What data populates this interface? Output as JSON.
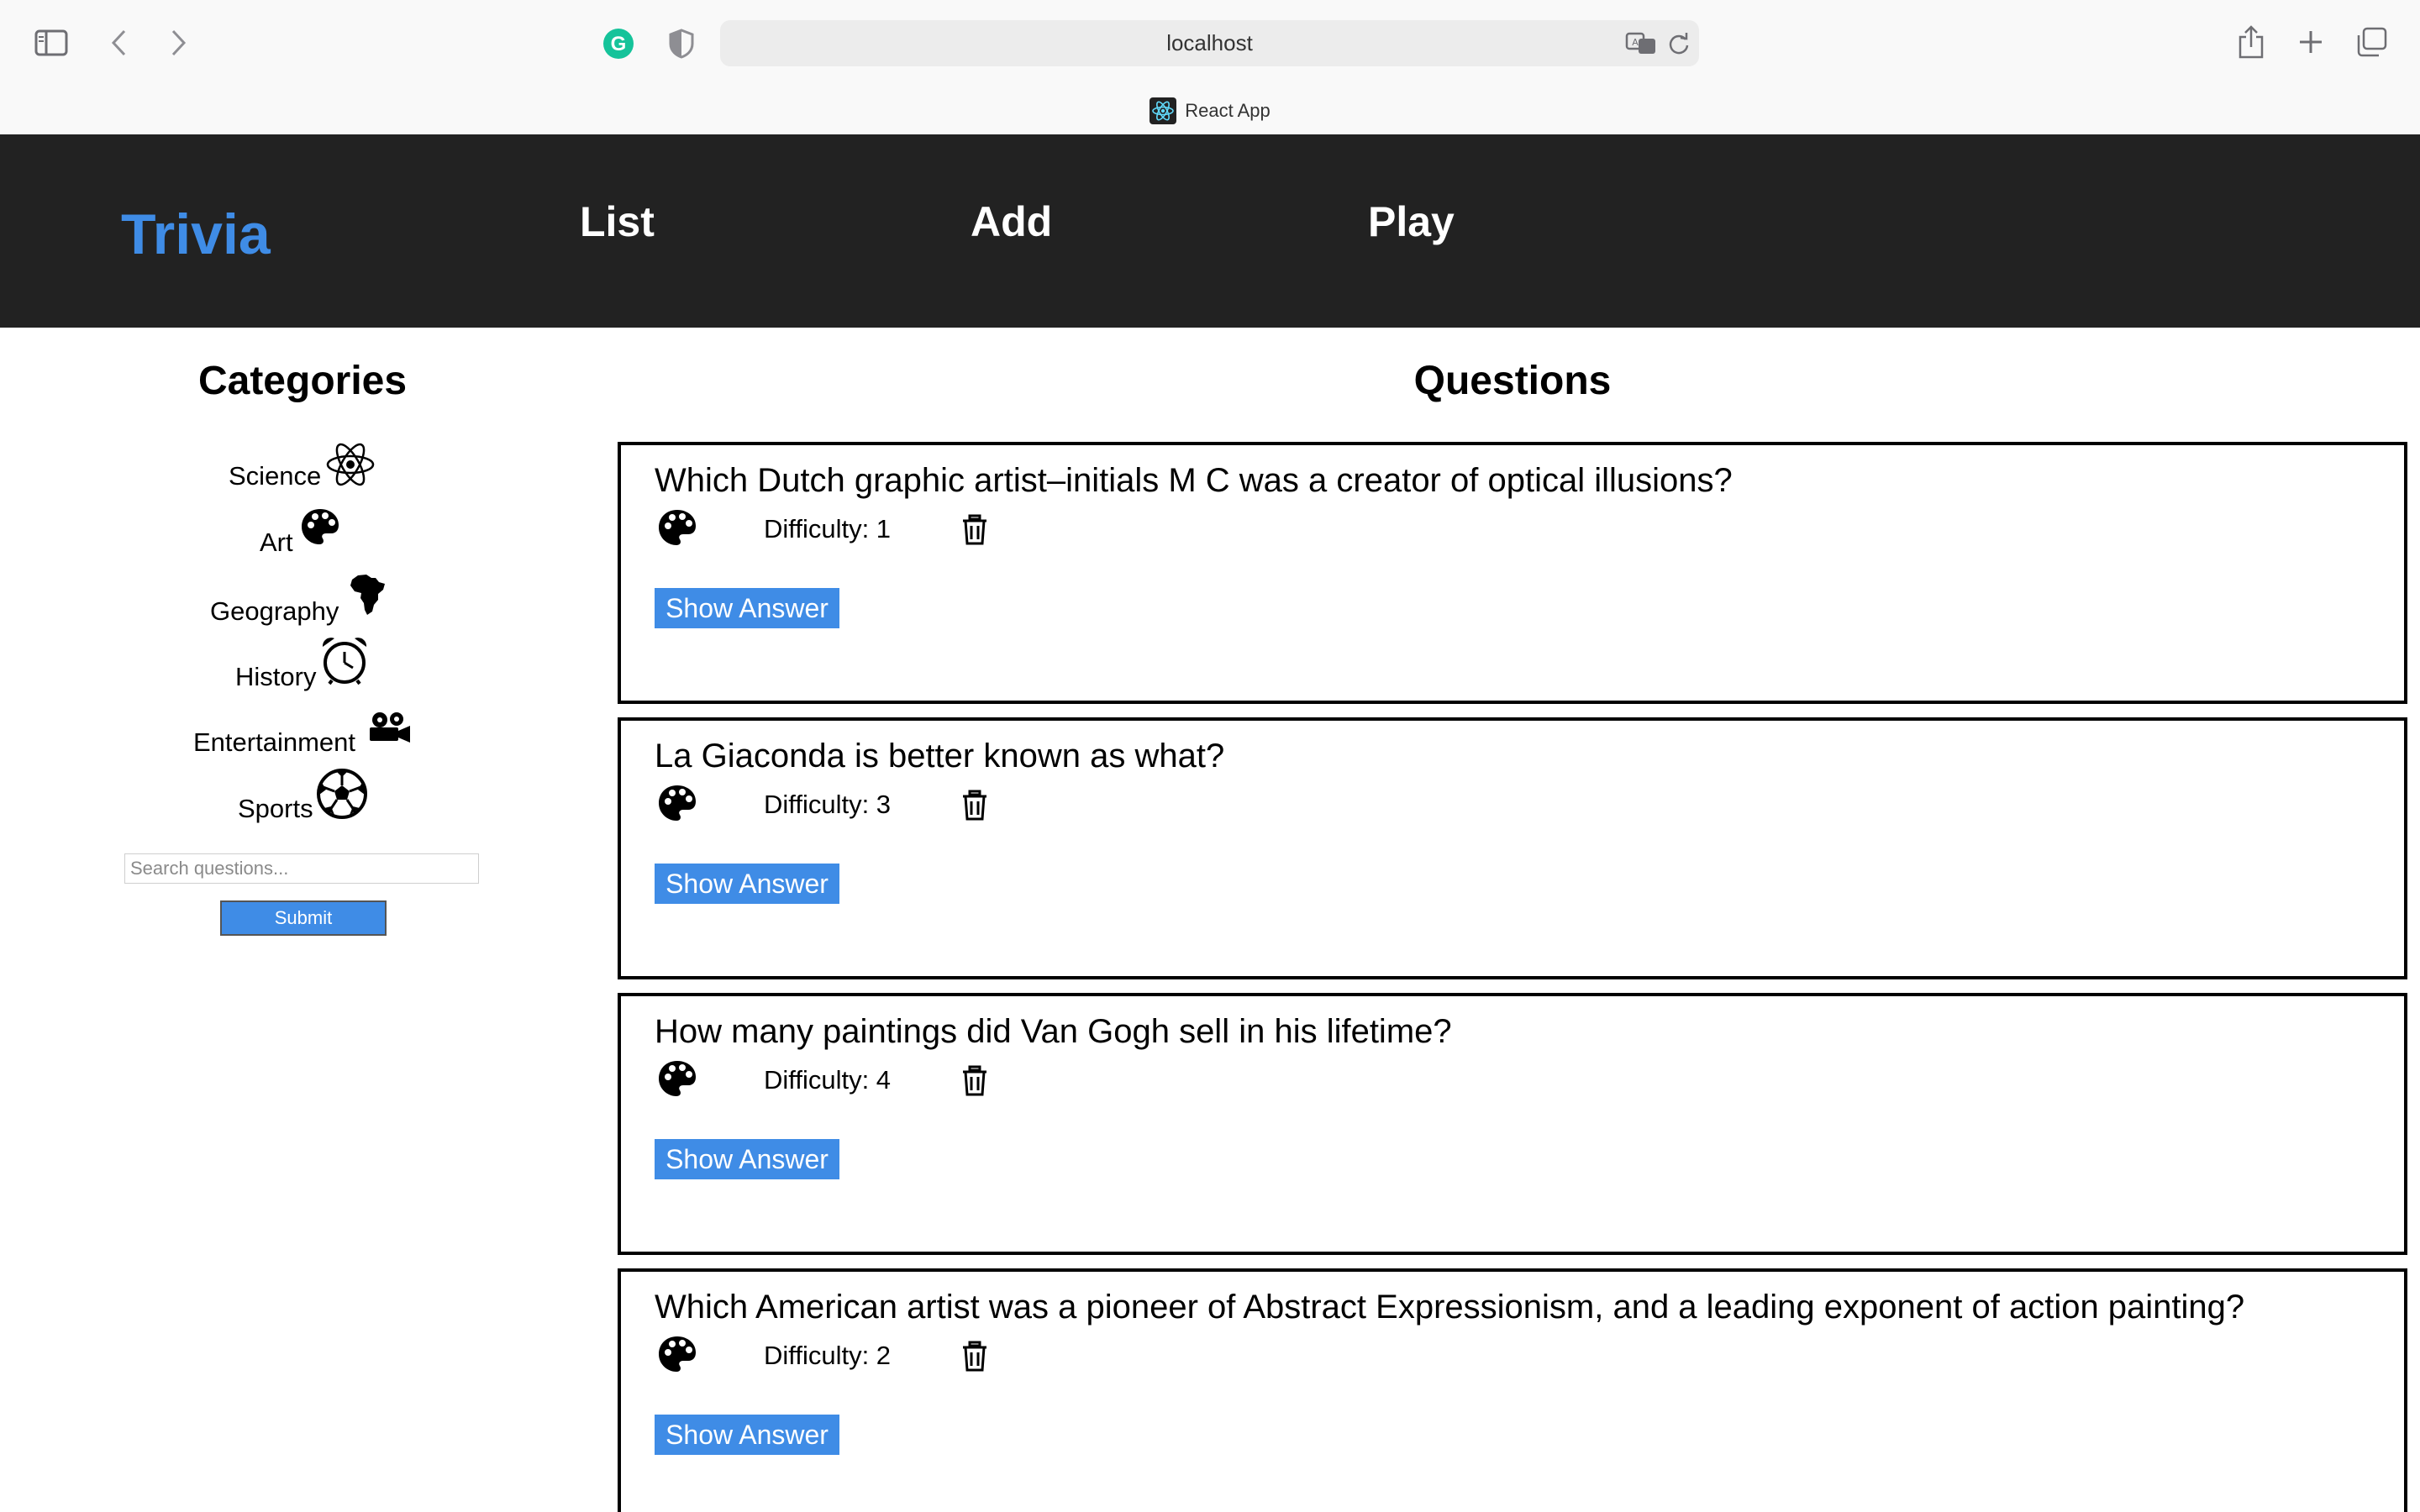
{
  "browser": {
    "url": "localhost",
    "tab_title": "React App",
    "icons": [
      "sidebar-icon",
      "back-icon",
      "forward-icon",
      "grammarly-icon",
      "shield-icon",
      "translate-icon",
      "reload-icon",
      "share-icon",
      "new-tab-icon",
      "tabs-overview-icon"
    ]
  },
  "header": {
    "brand": "Trivia",
    "nav": [
      "List",
      "Add",
      "Play"
    ]
  },
  "sidebar": {
    "title": "Categories",
    "categories": [
      {
        "label": "Science",
        "icon": "atom-icon"
      },
      {
        "label": "Art",
        "icon": "palette-icon"
      },
      {
        "label": "Geography",
        "icon": "africa-icon"
      },
      {
        "label": "History",
        "icon": "alarm-clock-icon"
      },
      {
        "label": "Entertainment",
        "icon": "film-projector-icon"
      },
      {
        "label": "Sports",
        "icon": "soccer-ball-icon"
      }
    ],
    "search": {
      "placeholder": "Search questions...",
      "value": ""
    },
    "submit_label": "Submit"
  },
  "main": {
    "title": "Questions",
    "questions": [
      {
        "text": "Which Dutch graphic artist–initials M C was a creator of optical illusions?",
        "category_icon": "palette-icon",
        "difficulty": "Difficulty: 1",
        "show_answer": "Show Answer"
      },
      {
        "text": "La Giaconda is better known as what?",
        "category_icon": "palette-icon",
        "difficulty": "Difficulty: 3",
        "show_answer": "Show Answer"
      },
      {
        "text": "How many paintings did Van Gogh sell in his lifetime?",
        "category_icon": "palette-icon",
        "difficulty": "Difficulty: 4",
        "show_answer": "Show Answer"
      },
      {
        "text": "Which American artist was a pioneer of Abstract Expressionism, and a leading exponent of action painting?",
        "category_icon": "palette-icon",
        "difficulty": "Difficulty: 2",
        "show_answer": "Show Answer"
      }
    ]
  },
  "colors": {
    "navbar": "#222222",
    "brand": "#3f8ce6",
    "button": "#3f8ce6"
  }
}
